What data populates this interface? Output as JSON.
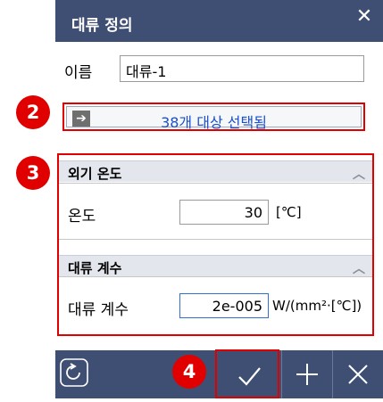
{
  "dialog": {
    "title": "대류 정의",
    "name_label": "이름",
    "name_value": "대류-1",
    "selection_text": "38개 대상 선택됨"
  },
  "badges": {
    "b2": "2",
    "b3": "3",
    "b4": "4"
  },
  "sections": {
    "ambient": {
      "title": "외기 온도",
      "temp_label": "온도",
      "temp_value": "30",
      "temp_unit": "[℃]"
    },
    "convection": {
      "title": "대류 계수",
      "coef_label": "대류 계수",
      "coef_value": "2e-005",
      "coef_unit": "W/(mm²·[℃])"
    }
  },
  "colors": {
    "header": "#3f4e73",
    "highlight": "#e00000",
    "link": "#1a4fcf"
  },
  "icons": {
    "close": "close-icon",
    "arrow": "arrow-right-icon",
    "reset": "reset-icon",
    "ok": "check-icon",
    "add": "plus-icon",
    "cancel": "close-icon"
  }
}
